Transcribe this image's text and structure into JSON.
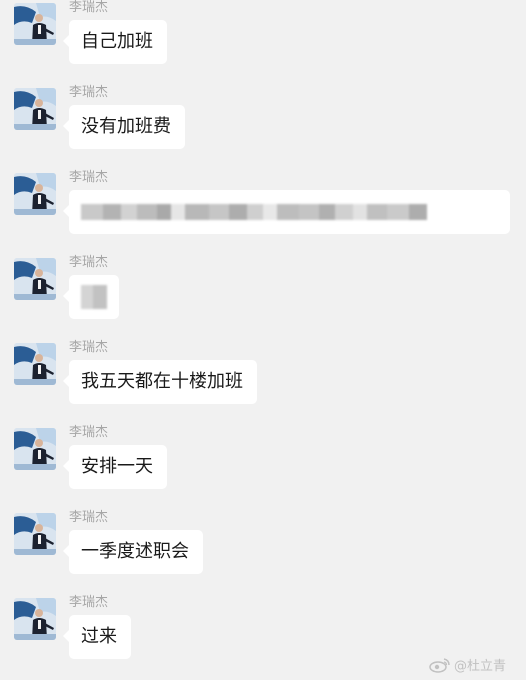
{
  "messages": [
    {
      "sender": "李瑞杰",
      "text": "自己加班"
    },
    {
      "sender": "李瑞杰",
      "text": "没有加班费"
    },
    {
      "sender": "李瑞杰",
      "text": null,
      "content_state": "blurred-text"
    },
    {
      "sender": "李瑞杰",
      "text": null,
      "content_state": "blurred-emoji"
    },
    {
      "sender": "李瑞杰",
      "text": "我五天都在十楼加班"
    },
    {
      "sender": "李瑞杰",
      "text": "安排一天"
    },
    {
      "sender": "李瑞杰",
      "text": "一季度述职会"
    },
    {
      "sender": "李瑞杰",
      "text": "过来"
    }
  ],
  "watermark": {
    "text": "@杜立青"
  },
  "colors": {
    "background": "#f1f1f1",
    "bubble": "#ffffff",
    "sender_name": "#a6a6a6",
    "message_text": "#1a1a1a"
  }
}
